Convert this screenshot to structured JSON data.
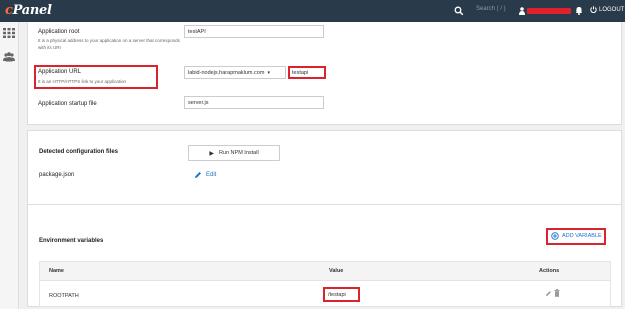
{
  "header": {
    "logo_prefix": "c",
    "logo_rest": "Panel",
    "search_placeholder": "Search ( / )",
    "logout_label": "LOGOUT"
  },
  "form": {
    "app_root": {
      "label": "Application root",
      "value": "testAPI",
      "help": "It is a physical address to your application on a server that corresponds with its URI"
    },
    "app_url": {
      "label": "Application URL",
      "help": "It is an HTTP/HTTPS link to your application",
      "domain": "labid-nodejs.harapmaklum.com",
      "path": "testapi"
    },
    "startup": {
      "label": "Application startup file",
      "value": "server.js"
    }
  },
  "config": {
    "title": "Detected configuration files",
    "run_npm_label": "Run NPM Install",
    "file_name": "package.json",
    "edit_label": "Edit"
  },
  "env": {
    "title": "Environment variables",
    "add_label": "ADD VARIABLE",
    "columns": [
      "Name",
      "Value",
      "Actions"
    ],
    "rows": [
      {
        "name": "ROOTPATH",
        "value": "/testapi"
      }
    ]
  },
  "colors": {
    "topbar": "#293a4a",
    "accent_red": "#d9232d",
    "link_blue": "#1a73c7"
  }
}
